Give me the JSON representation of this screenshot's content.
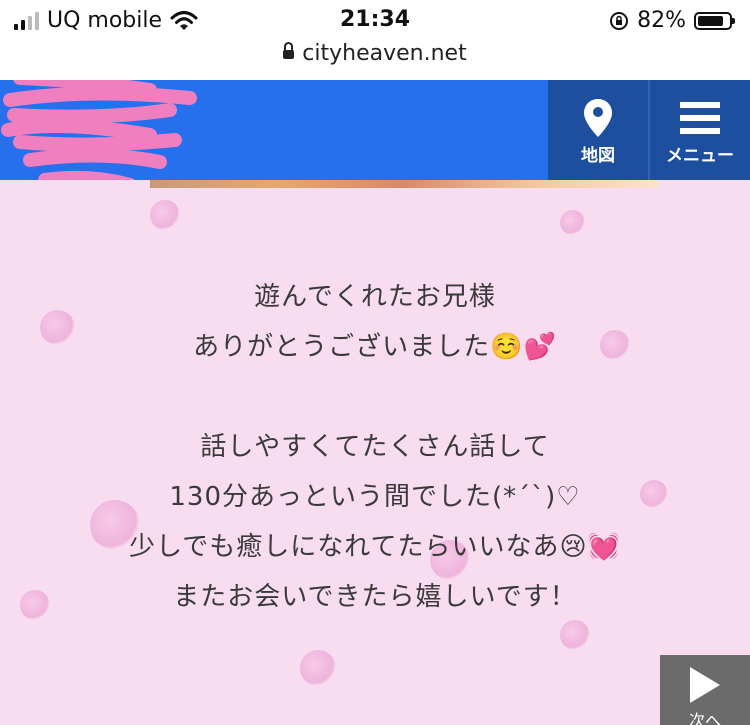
{
  "status_bar": {
    "carrier": "UQ mobile",
    "time": "21:34",
    "battery_percent": "82%",
    "battery_level": 0.82
  },
  "browser": {
    "url": "cityheaven.net"
  },
  "header": {
    "brand_color": "#2670ee",
    "map_label": "地図",
    "menu_label": "メニュー",
    "map_icon": "map-pin-icon",
    "menu_icon": "hamburger-menu-icon"
  },
  "post": {
    "lines": [
      "遊んでくれたお兄様",
      "ありがとうございました☺️💕",
      "",
      "話しやすくてたくさん話して",
      "130分あっという間でした(*´`)♡",
      "少しでも癒しになれてたらいいなあ😢💓",
      "またお会いできたら嬉しいです！"
    ]
  },
  "nav": {
    "next_label": "次へ"
  }
}
